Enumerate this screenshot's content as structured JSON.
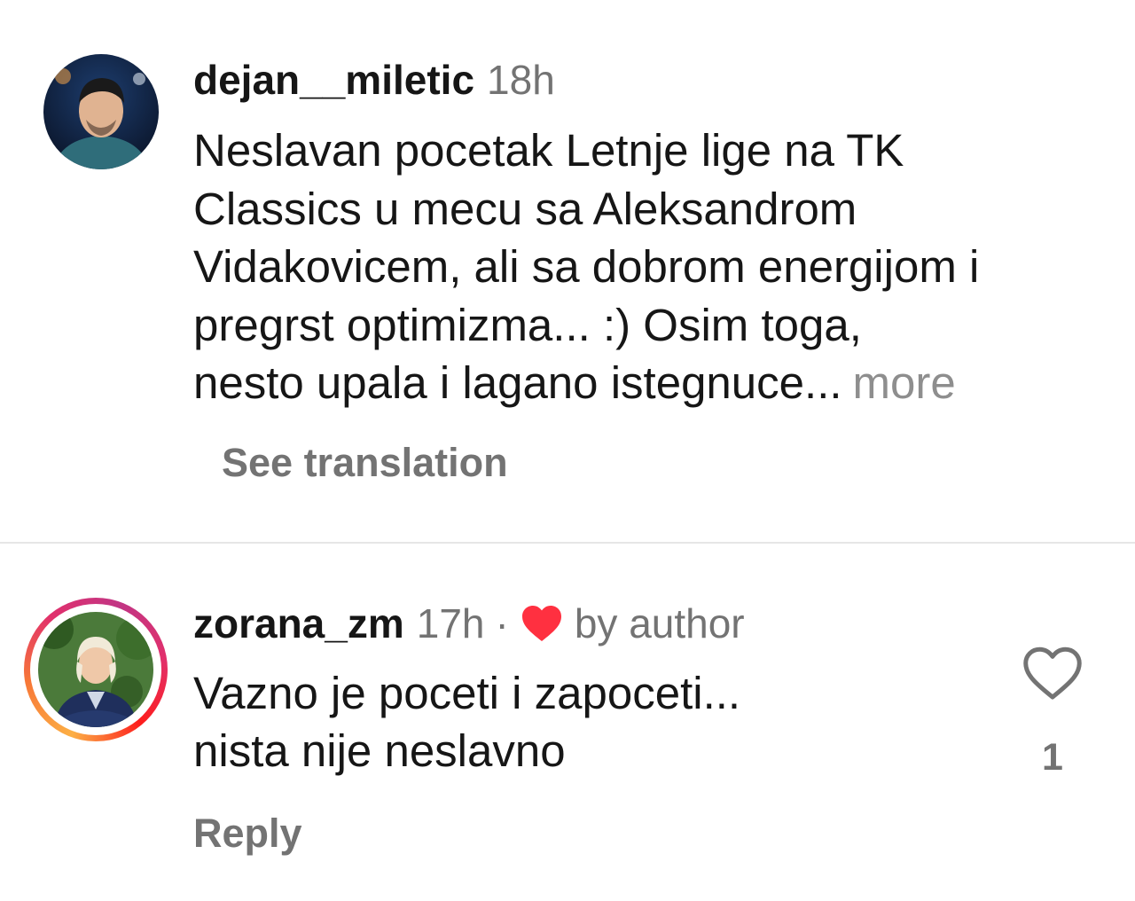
{
  "caption": {
    "username": "dejan__miletic",
    "time": "18h",
    "lines": [
      "Neslavan pocetak Letnje lige na TK",
      "Classics u mecu sa Aleksandrom",
      "Vidakovicem, ali sa dobrom energijom i",
      "pregrst optimizma... :) Osim toga,",
      "nesto upala i lagano istegnuce..."
    ],
    "more_label": "more",
    "see_translation_label": "See translation"
  },
  "comment": {
    "username": "zorana_zm",
    "time": "17h",
    "separator": "·",
    "badge_icon": "red-heart-icon",
    "badge_label": "by author",
    "lines": [
      "Vazno je poceti i zapoceti...",
      "nista nije neslavno"
    ],
    "reply_label": "Reply",
    "like_icon": "heart-outline-icon",
    "like_count": "1"
  },
  "colors": {
    "primary_text": "#161616",
    "secondary_text": "#737373",
    "heart_red": "#ff3040",
    "divider": "#e6e6e6"
  }
}
